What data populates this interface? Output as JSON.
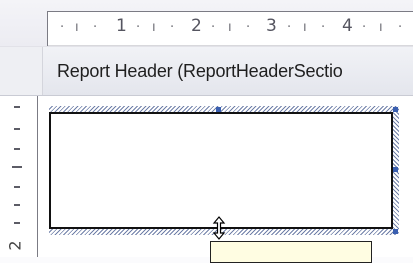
{
  "ruler": {
    "marks": [
      "·",
      "ı",
      "·",
      "1",
      "·",
      "ı",
      "·",
      "2",
      "·",
      "ı",
      "·",
      "3",
      "·",
      "ı",
      "·",
      "4",
      "·",
      "ı",
      "·"
    ]
  },
  "section": {
    "label": "Report Header  (ReportHeaderSectio"
  },
  "vertical_ruler": {
    "number": "2"
  }
}
